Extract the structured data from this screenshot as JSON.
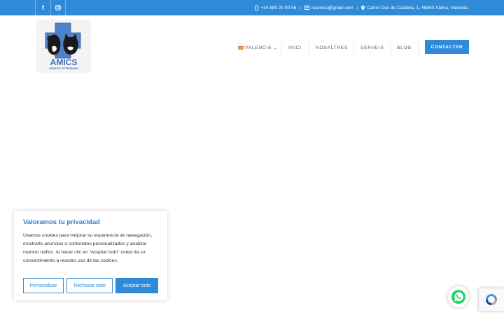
{
  "topbar": {
    "social": [
      {
        "name": "facebook",
        "glyph": "f"
      },
      {
        "name": "instagram",
        "glyph": "◎"
      }
    ],
    "phone": "+34 680 20 90 56",
    "email": "cvamics@gmail.com",
    "address": "Carrer Duc de Calàbria, 1, 46800 Xàtiva, Valencia",
    "separator": "|"
  },
  "logo": {
    "brand": "AMICS",
    "tagline": "CENTRE VETERINARI"
  },
  "nav": {
    "language": "VALENCIÀ",
    "language_caret": "⌄",
    "items": [
      "INICI",
      "NOSALTRES",
      "SERVEIS",
      "BLOG"
    ],
    "cta": "CONTACTAR"
  },
  "cookie": {
    "title": "Valoramos tu privacidad",
    "text": "Usamos cookies para mejorar su experiencia de navegación, mostrarle anuncios o contenidos personalizados y analizar nuestro tráfico. Al hacer clic en “Aceptar todo” usted da su consentimiento a nuestro uso de las cookies.",
    "buttons": {
      "customize": "Personalizar",
      "reject": "Rechazar todo",
      "accept": "Aceptar todo"
    }
  },
  "colors": {
    "accent": "#2f8bd7",
    "title_blue": "#2f7ec5",
    "whatsapp_green": "#25d366"
  }
}
